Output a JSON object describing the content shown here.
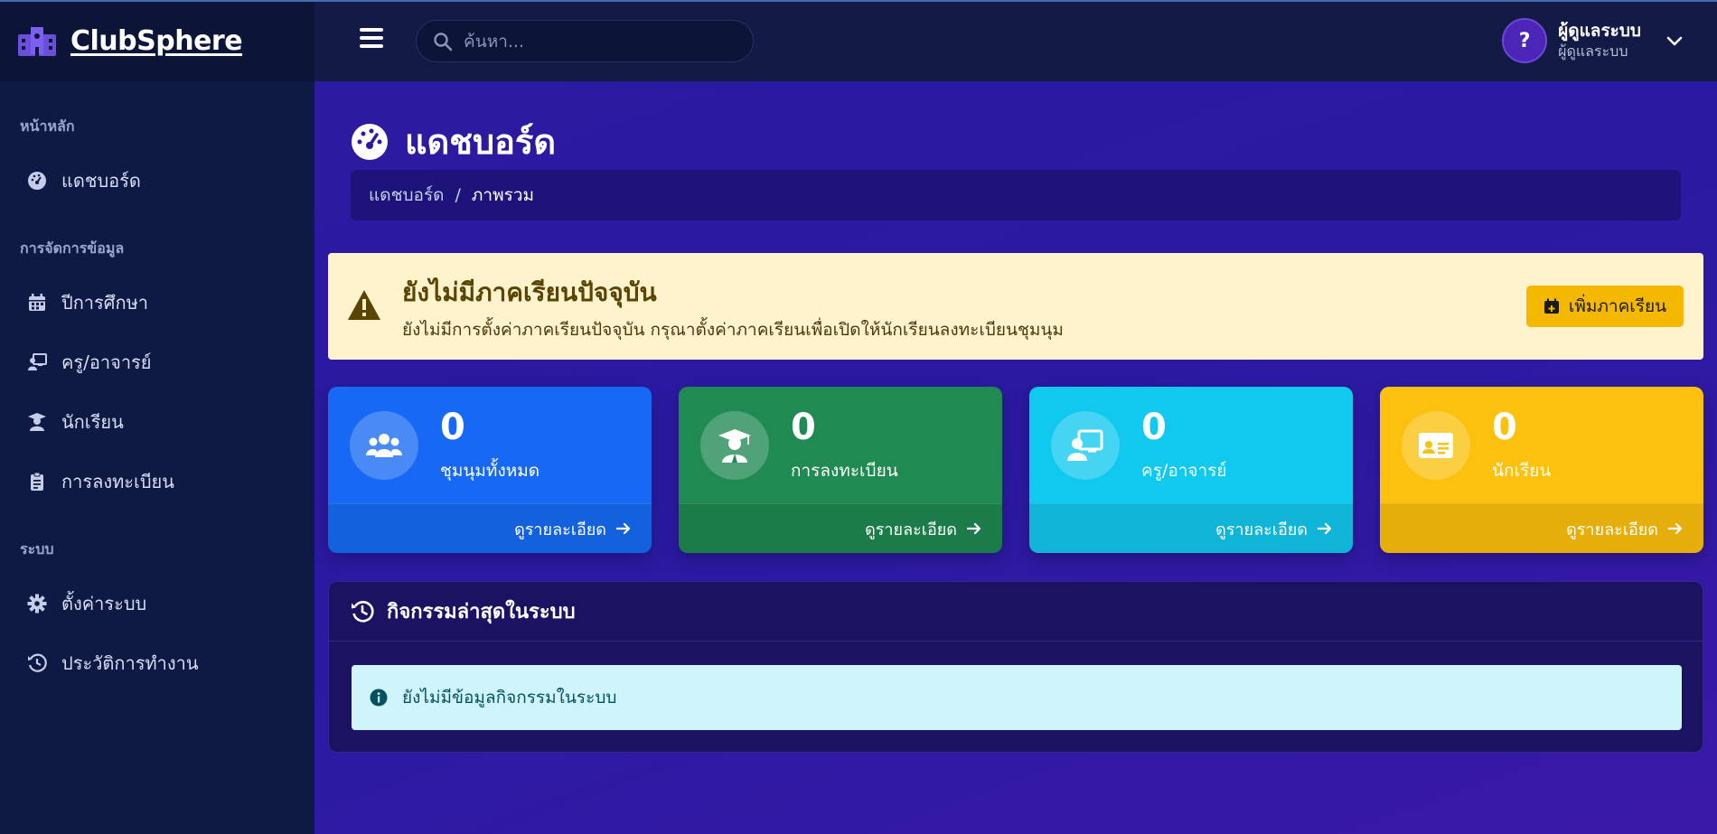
{
  "app": {
    "name": "ClubSphere"
  },
  "sidebar": {
    "sections": [
      {
        "title": "หน้าหลัก",
        "items": [
          {
            "label": "แดชบอร์ด",
            "icon": "dashboard-gauge-icon"
          }
        ]
      },
      {
        "title": "การจัดการข้อมูล",
        "items": [
          {
            "label": "ปีการศึกษา",
            "icon": "calendar-icon"
          },
          {
            "label": "ครู/อาจารย์",
            "icon": "chalkboard-teacher-icon"
          },
          {
            "label": "นักเรียน",
            "icon": "graduate-icon"
          },
          {
            "label": "การลงทะเบียน",
            "icon": "clipboard-icon"
          }
        ]
      },
      {
        "title": "ระบบ",
        "items": [
          {
            "label": "ตั้งค่าระบบ",
            "icon": "gear-icon"
          },
          {
            "label": "ประวัติการทำงาน",
            "icon": "history-icon"
          }
        ]
      }
    ]
  },
  "topbar": {
    "search_placeholder": "ค้นหา...",
    "user": {
      "avatar": "?",
      "name": "ผู้ดูแลระบบ",
      "role": "ผู้ดูแลระบบ"
    }
  },
  "page": {
    "title": "แดชบอร์ด",
    "breadcrumb": {
      "item1": "แดชบอร์ด",
      "separator": "/",
      "item2": "ภาพรวม"
    }
  },
  "alert": {
    "title": "ยังไม่มีภาคเรียนปัจจุบัน",
    "text": "ยังไม่มีการตั้งค่าภาคเรียนปัจจุบัน กรุณาตั้งค่าภาคเรียนเพื่อเปิดให้นักเรียนลงทะเบียนชุมนุม",
    "button": "เพิ่มภาคเรียน"
  },
  "cards": [
    {
      "value": "0",
      "label": "ชุมนุมทั้งหมด",
      "link": "ดูรายละเอียด",
      "icon": "users-icon",
      "color": "#1769f5",
      "footer_color": "#1461dd"
    },
    {
      "value": "0",
      "label": "การลงทะเบียน",
      "link": "ดูรายละเอียด",
      "icon": "graduate-icon",
      "color": "#1f8a52",
      "footer_color": "#1b7c49"
    },
    {
      "value": "0",
      "label": "ครู/อาจารย์",
      "link": "ดูรายละเอียด",
      "icon": "chalkboard-teacher-icon",
      "color": "#11c8ee",
      "footer_color": "#0fb4d6"
    },
    {
      "value": "0",
      "label": "นักเรียน",
      "link": "ดูรายละเอียด",
      "icon": "id-card-icon",
      "color": "#fcc10e",
      "footer_color": "#e5ae0b"
    }
  ],
  "activity": {
    "title": "กิจกรรมล่าสุดในระบบ",
    "empty_text": "ยังไม่มีข้อมูลกิจกรรมในระบบ"
  }
}
